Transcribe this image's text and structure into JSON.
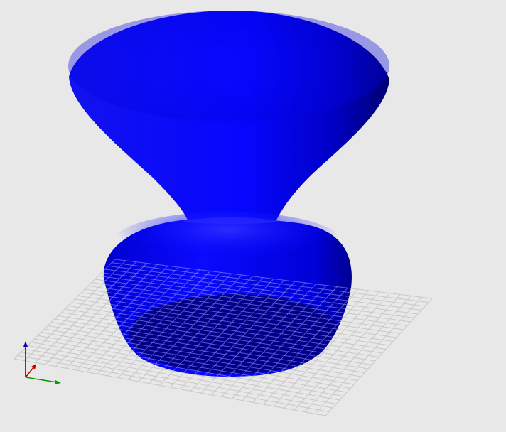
{
  "viewport": {
    "background": "#e8e8e8",
    "object": {
      "name": "revolved-vase-solid",
      "color": "#0000ff",
      "shade_dark": "#000088",
      "highlight": "#3a3aff"
    },
    "grid": {
      "color": "#c8c8c8",
      "front_color": "#a0a0ff"
    },
    "axes": {
      "x_color": "#00a000",
      "y_color": "#c00000",
      "z_color": "#0000c0"
    }
  }
}
